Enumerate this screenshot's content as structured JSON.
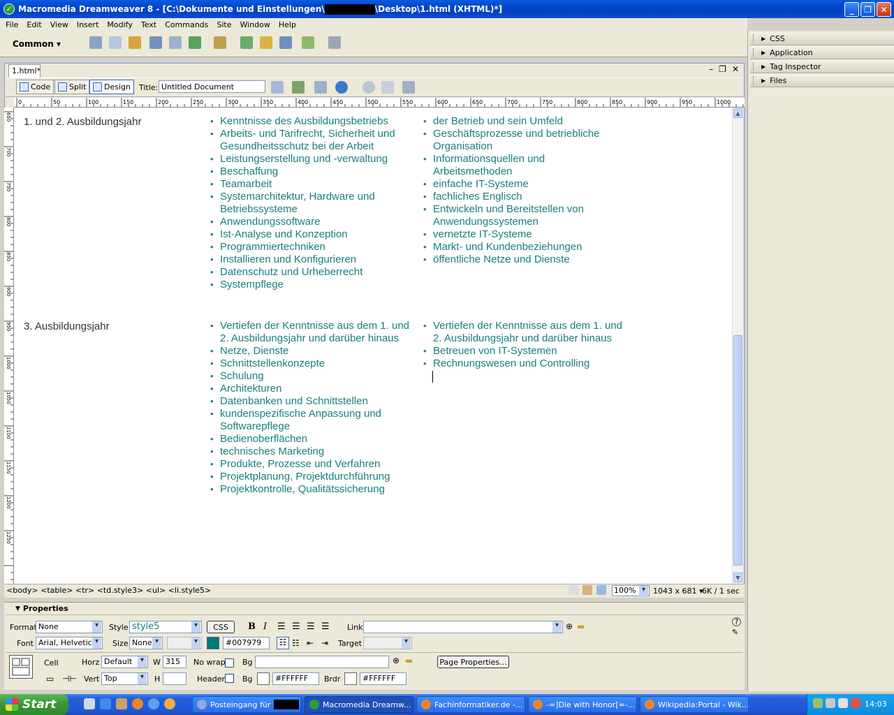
{
  "window": {
    "title_left": "Macromedia Dreamweaver 8 - [C:\\Dokumente und Einstellungen\\",
    "title_right": "\\Desktop\\1.html (XHTML)*]"
  },
  "menu": [
    "File",
    "Edit",
    "View",
    "Insert",
    "Modify",
    "Text",
    "Commands",
    "Site",
    "Window",
    "Help"
  ],
  "insertbar": {
    "category": "Common"
  },
  "panels": [
    "CSS",
    "Application",
    "Tag Inspector",
    "Files"
  ],
  "document": {
    "tab": "1.html*",
    "views": {
      "code": "Code",
      "split": "Split",
      "design": "Design"
    },
    "title_label": "Title:",
    "title_value": "Untitled Document"
  },
  "ruler": {
    "top_ticks": [
      "0",
      "50",
      "100",
      "150",
      "200",
      "250",
      "300",
      "350",
      "400",
      "450",
      "500",
      "550",
      "600",
      "650",
      "700",
      "750",
      "800",
      "850",
      "900",
      "950",
      "1000"
    ],
    "left_ticks": [
      "650",
      "700",
      "750",
      "800",
      "850",
      "900",
      "950",
      "1000",
      "1050",
      "1100",
      "1150",
      "1200",
      "1250"
    ]
  },
  "content": {
    "rows": [
      {
        "label": "1. und 2. Ausbildungsjahr",
        "col1": [
          "Kenntnisse des Ausbildungsbetriebs",
          "Arbeits- und Tarifrecht, Sicherheit und Gesundheitsschutz bei der Arbeit",
          "Leistungserstellung und -verwaltung",
          "Beschaffung",
          "Teamarbeit",
          "Systemarchitektur, Hardware und Betriebssysteme",
          "Anwendungssoftware",
          "Ist-Analyse und Konzeption",
          "Programmiertechniken",
          "Installieren und Konfigurieren",
          "Datenschutz und Urheberrecht",
          "Systempflege"
        ],
        "col2": [
          "der Betrieb und sein Umfeld",
          "Geschäftsprozesse und betriebliche Organisation",
          "Informationsquellen und Arbeitsmethoden",
          "einfache IT-Systeme",
          "fachliches Englisch",
          "Entwickeln und Bereitstellen von Anwendungssystemen",
          "vernetzte IT-Systeme",
          "Markt- und Kundenbeziehungen",
          "öffentliche Netze und Dienste"
        ]
      },
      {
        "label": "3. Ausbildungsjahr",
        "col1": [
          "Vertiefen der Kenntnisse aus dem 1. und 2. Ausbildungsjahr und darüber hinaus",
          "Netze, Dienste",
          "Schnittstellenkonzepte",
          "Schulung",
          "Architekturen",
          "Datenbanken und Schnittstellen",
          "kundenspezifische Anpassung und Softwarepflege",
          "Bedienoberflächen",
          "technisches Marketing",
          "Produkte, Prozesse und Verfahren",
          "Projektplanung, Projektdurchführung",
          "Projektkontrolle, Qualitätssicherung"
        ],
        "col2": [
          "Vertiefen der Kenntnisse aus dem 1. und 2. Ausbildungsjahr und darüber hinaus",
          "Betreuen von IT-Systemen",
          "Rechnungswesen und Controlling"
        ]
      }
    ]
  },
  "statusbar": {
    "tag_selector": "<body> <table> <tr> <td.style3> <ul> <li.style5>",
    "zoom": "100%",
    "window_size": "1043 x 681",
    "doc_size": "6K / 1 sec"
  },
  "properties": {
    "header": "Properties",
    "format_label": "Format",
    "format_value": "None",
    "style_label": "Style",
    "style_value": "style5",
    "css_button": "CSS",
    "bold": "B",
    "italic": "I",
    "link_label": "Link",
    "link_value": "",
    "font_label": "Font",
    "font_value": "Arial, Helvetica",
    "size_label": "Size",
    "size_value": "None",
    "color_value": "#007979",
    "target_label": "Target",
    "cell_label": "Cell",
    "horz_label": "Horz",
    "horz_value": "Default",
    "w_label": "W",
    "w_value": "315",
    "nowrap_label": "No wrap",
    "bg_label": "Bg",
    "page_properties": "Page Properties...",
    "vert_label": "Vert",
    "vert_value": "Top",
    "h_label": "H",
    "h_value": "",
    "header_label": "Header",
    "bg_color": "#FFFFFF",
    "brdr_label": "Brdr",
    "brdr_color": "#FFFFFF"
  },
  "taskbar": {
    "start": "Start",
    "tasks": [
      "Posteingang für",
      "Macromedia Dreamw...",
      "Fachinformatiker.de -...",
      "-=]Die with Honor[=-...",
      "Wikipedia:Portal - Wik..."
    ],
    "clock": "14:03"
  },
  "colors": {
    "text_accent": "#1a7e7e",
    "titlebar": "#0a5be0",
    "taskbar": "#245edb"
  }
}
